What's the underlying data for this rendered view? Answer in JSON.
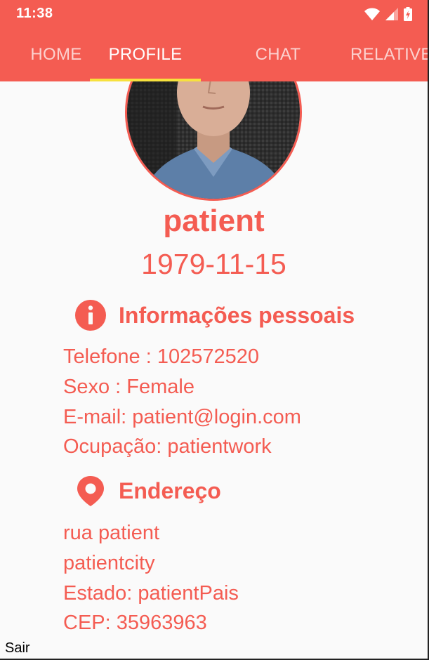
{
  "status_bar": {
    "time": "11:38",
    "icons": [
      "wifi-icon",
      "signal-icon",
      "battery-icon"
    ]
  },
  "tabs": [
    {
      "label": "HOME",
      "active": false
    },
    {
      "label": "PROFILE",
      "active": true
    },
    {
      "label": "CHAT",
      "active": false
    },
    {
      "label": "RELATIVE",
      "active": false
    }
  ],
  "profile": {
    "name": "patient",
    "birthdate": "1979-11-15"
  },
  "personal_info": {
    "icon": "info-icon",
    "title": "Informações pessoais",
    "lines": [
      "Telefone : 102572520",
      "Sexo : Female",
      "E-mail: patient@login.com",
      "Ocupação: patientwork"
    ]
  },
  "address": {
    "icon": "location-pin-icon",
    "title": "Endereço",
    "lines": [
      "rua patient",
      "patientcity",
      "Estado: patientPais",
      "CEP: 35963963"
    ]
  },
  "logout_label": "Sair",
  "colors": {
    "accent": "#f45c52",
    "tab_indicator": "#f7e13e",
    "background": "#fafafa"
  }
}
